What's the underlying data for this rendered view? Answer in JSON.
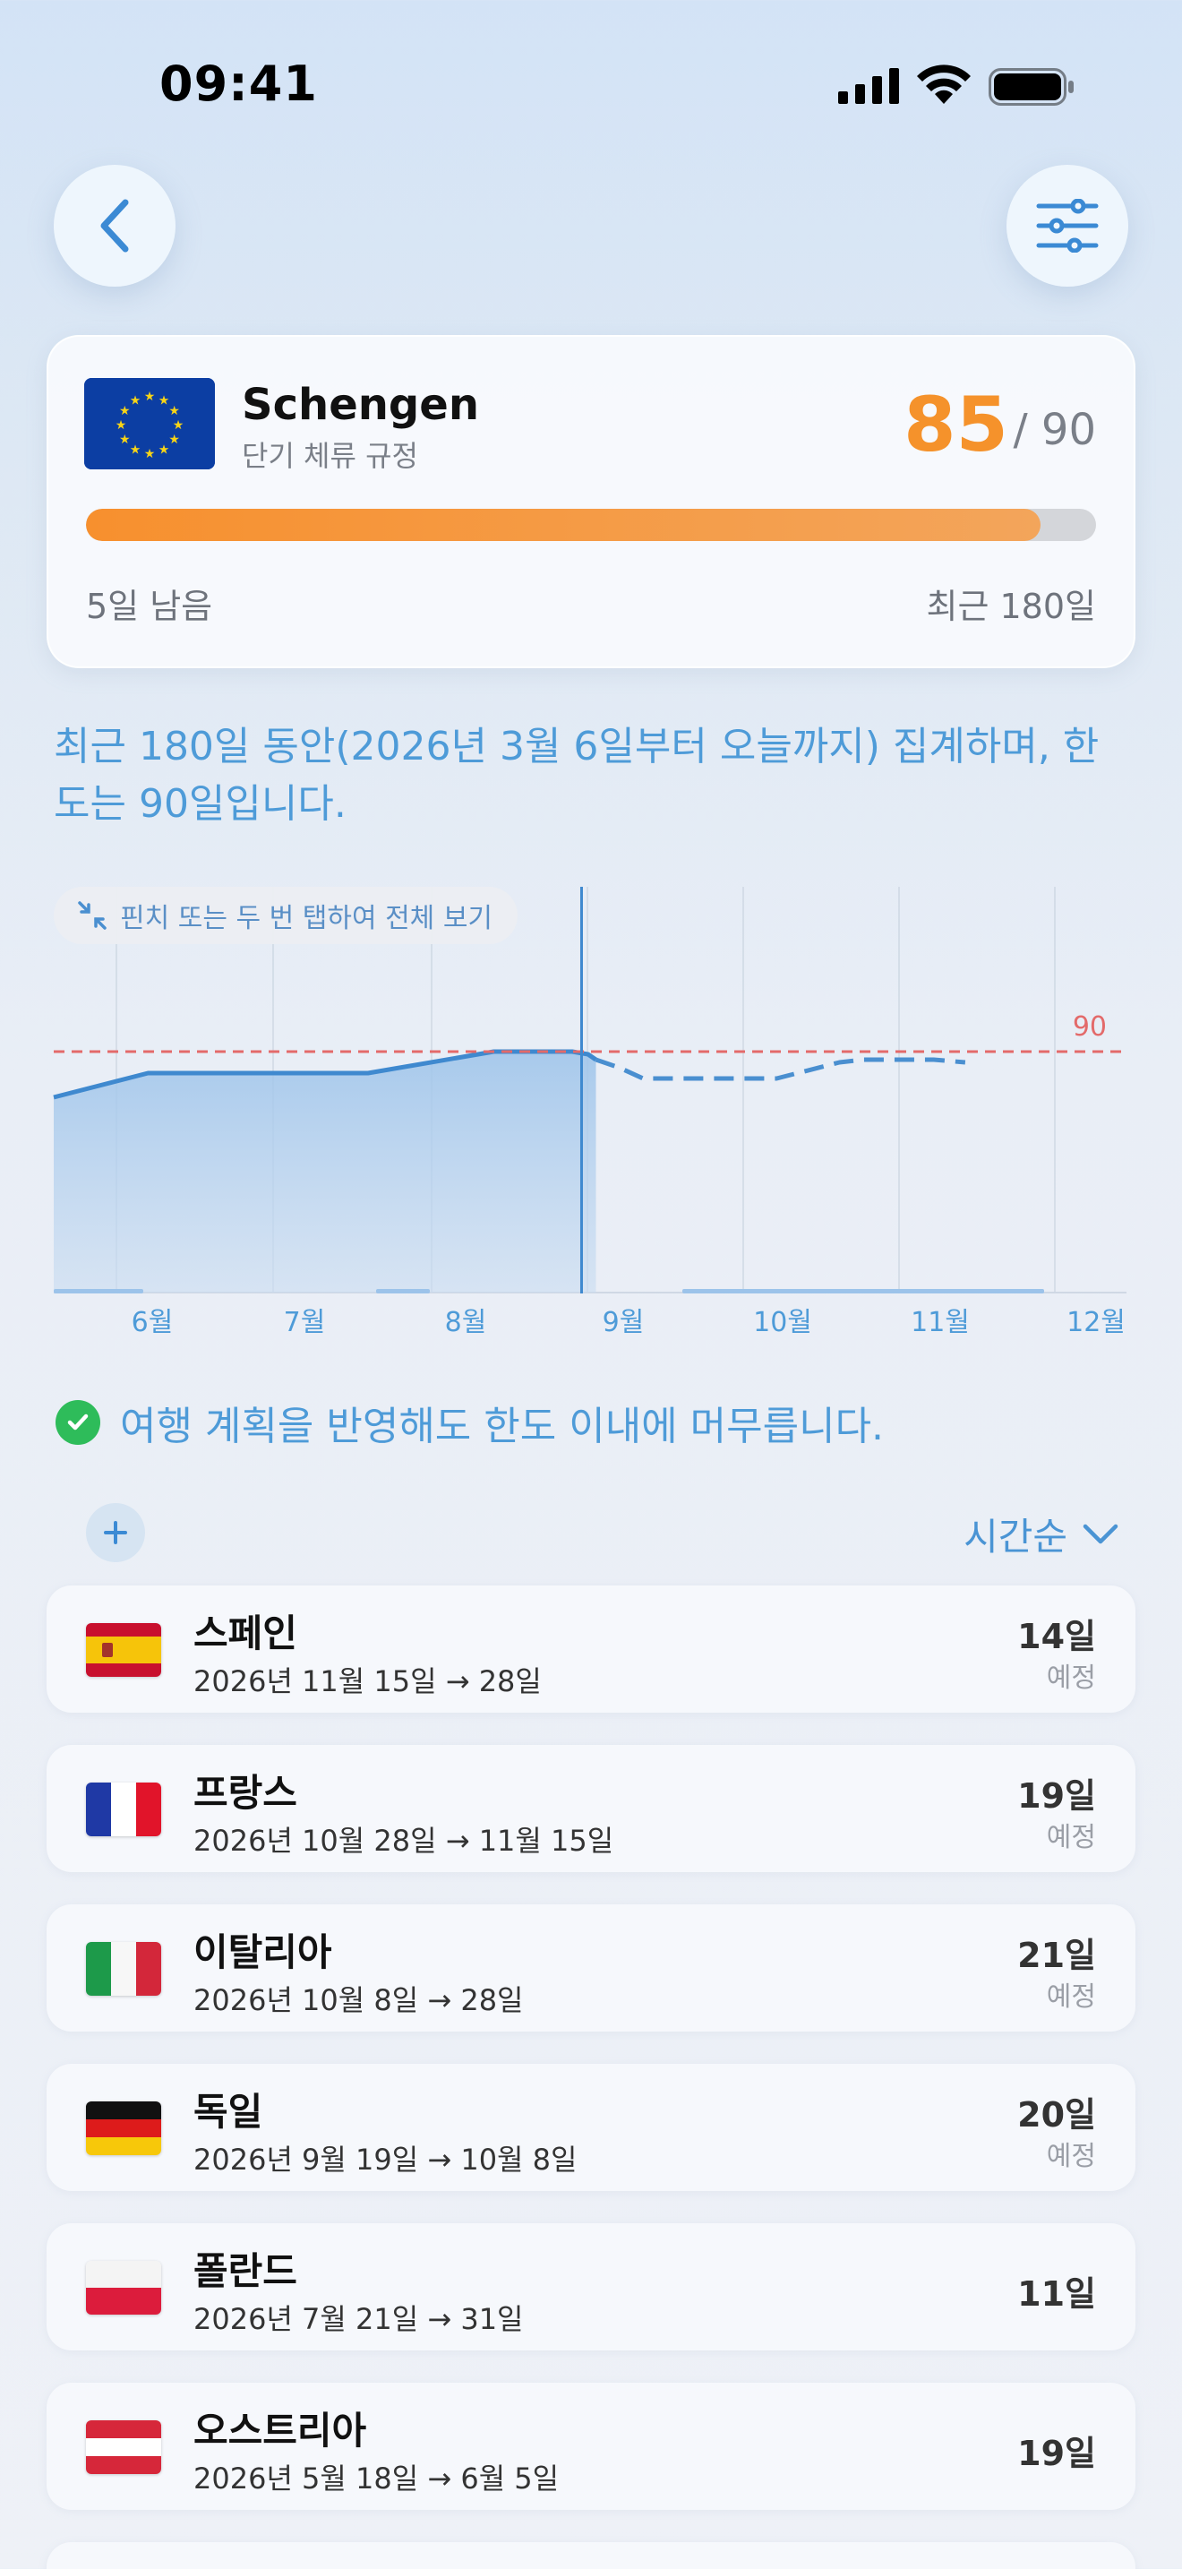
{
  "status_bar": {
    "time": "09:41"
  },
  "header": {
    "back_icon": "chevron-left-icon",
    "filter_icon": "sliders-icon"
  },
  "summary": {
    "title": "Schengen",
    "subtitle": "단기 체류 규정",
    "used": "85",
    "max": "/ 90",
    "progress": 0.945,
    "remaining": "5일 남음",
    "window": "최근 180일",
    "accent_color": "#f5922b"
  },
  "description": "최근 180일 동안(2026년 3월 6일부터 오늘까지) 집계하며, 한도는 90일입니다.",
  "pinch_hint": "핀치 또는 두 번 탭하여 전체 보기",
  "chart_data": {
    "type": "line",
    "limit_label": "90",
    "limit": 90,
    "x_ticks": [
      "6월",
      "7월",
      "8월",
      "9월",
      "10월",
      "11월",
      "12월"
    ],
    "series": [
      {
        "style": "solid",
        "x": [
          0,
          0.6,
          2.0,
          2.8,
          2.9,
          3.3,
          3.4,
          3.45
        ],
        "y": [
          73,
          82,
          82,
          90,
          90,
          90,
          89,
          87
        ]
      },
      {
        "style": "dashed",
        "x": [
          3.45,
          3.6,
          3.75,
          4.4,
          4.6,
          5.0,
          5.15,
          5.6,
          5.8
        ],
        "y": [
          87,
          84,
          80,
          80,
          80,
          86,
          87,
          87,
          86
        ]
      }
    ],
    "ylim": [
      0,
      100
    ]
  },
  "status_message": "여행 계획을 반영해도 한도 이내에 머무릅니다.",
  "sort_label": "시간순",
  "trips": [
    {
      "name": "스페인",
      "dates": "2026년 11월 15일 → 28일",
      "days": "14일",
      "planned": "예정",
      "flag": "spain"
    },
    {
      "name": "프랑스",
      "dates": "2026년 10월 28일 → 11월 15일",
      "days": "19일",
      "planned": "예정",
      "flag": "france"
    },
    {
      "name": "이탈리아",
      "dates": "2026년 10월 8일 → 28일",
      "days": "21일",
      "planned": "예정",
      "flag": "italy"
    },
    {
      "name": "독일",
      "dates": "2026년 9월 19일 → 10월 8일",
      "days": "20일",
      "planned": "예정",
      "flag": "germany"
    },
    {
      "name": "폴란드",
      "dates": "2026년 7월 21일 → 31일",
      "days": "11일",
      "planned": "",
      "flag": "poland"
    },
    {
      "name": "오스트리아",
      "dates": "2026년 5월 18일 → 6월 5일",
      "days": "19일",
      "planned": "",
      "flag": "austria"
    }
  ]
}
